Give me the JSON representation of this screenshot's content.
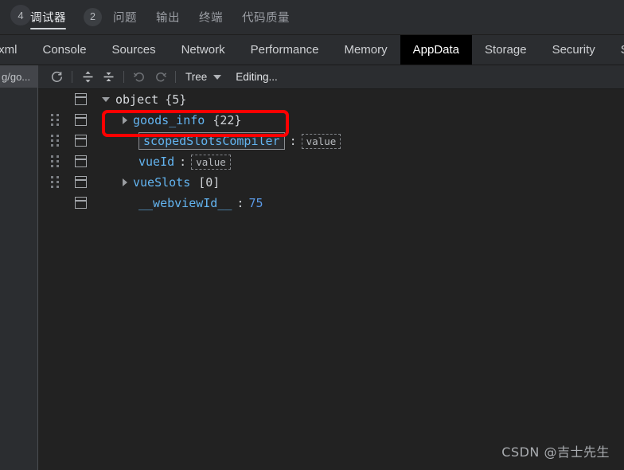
{
  "toolwindow_tabs": {
    "left_cut_badge": "4",
    "items": [
      {
        "label": "调试器",
        "count": "2",
        "active": true
      },
      {
        "label": "问题",
        "count": "",
        "active": false
      },
      {
        "label": "输出",
        "count": "",
        "active": false
      },
      {
        "label": "终端",
        "count": "",
        "active": false
      },
      {
        "label": "代码质量",
        "count": "",
        "active": false
      }
    ]
  },
  "devtools_tabs": {
    "items": [
      {
        "label": "/xml",
        "active": false,
        "clipped_left": true
      },
      {
        "label": "Console",
        "active": false
      },
      {
        "label": "Sources",
        "active": false
      },
      {
        "label": "Network",
        "active": false
      },
      {
        "label": "Performance",
        "active": false
      },
      {
        "label": "Memory",
        "active": false
      },
      {
        "label": "AppData",
        "active": true
      },
      {
        "label": "Storage",
        "active": false
      },
      {
        "label": "Security",
        "active": false
      },
      {
        "label": "Se",
        "active": false,
        "clipped_right": true
      }
    ]
  },
  "gutter": {
    "file_label": "g/go..."
  },
  "toolbar": {
    "refresh_icon": "refresh-icon",
    "expand_all_icon": "expand-all-icon",
    "collapse_all_icon": "collapse-all-icon",
    "undo_icon": "undo-icon",
    "redo_icon": "redo-icon",
    "view_mode": "Tree",
    "dropdown_icon": "chevron-down-icon",
    "status": "Editing..."
  },
  "tree": {
    "rows": [
      {
        "indent": 0,
        "toggle": "down",
        "key": "object",
        "key_style": "plain",
        "suffix": "{5}",
        "has_handle": false,
        "boxed_key": false,
        "value_kind": "none",
        "value": ""
      },
      {
        "indent": 1,
        "toggle": "right",
        "key": "goods_info",
        "key_style": "blue",
        "suffix": "{22}",
        "has_handle": true,
        "boxed_key": false,
        "value_kind": "none",
        "value": "",
        "highlighted": true
      },
      {
        "indent": 1,
        "toggle": "none",
        "key": "scopedSlotsCompiler",
        "key_style": "blue",
        "suffix": "",
        "has_handle": true,
        "boxed_key": true,
        "value_kind": "dashed",
        "value": "value"
      },
      {
        "indent": 1,
        "toggle": "none",
        "key": "vueId",
        "key_style": "blue",
        "suffix": "",
        "has_handle": true,
        "boxed_key": false,
        "value_kind": "dashed",
        "value": "value"
      },
      {
        "indent": 1,
        "toggle": "right",
        "key": "vueSlots",
        "key_style": "blue",
        "suffix": "[0]",
        "has_handle": true,
        "boxed_key": false,
        "value_kind": "none",
        "value": ""
      },
      {
        "indent": 1,
        "toggle": "none",
        "key": "__webviewId__",
        "key_style": "blue",
        "suffix": "",
        "has_handle": false,
        "boxed_key": false,
        "value_kind": "number",
        "value": "75"
      }
    ]
  },
  "annotation": {
    "color": "#fe0000",
    "target": "goods_info"
  },
  "watermark": {
    "text": "CSDN @吉士先生"
  }
}
